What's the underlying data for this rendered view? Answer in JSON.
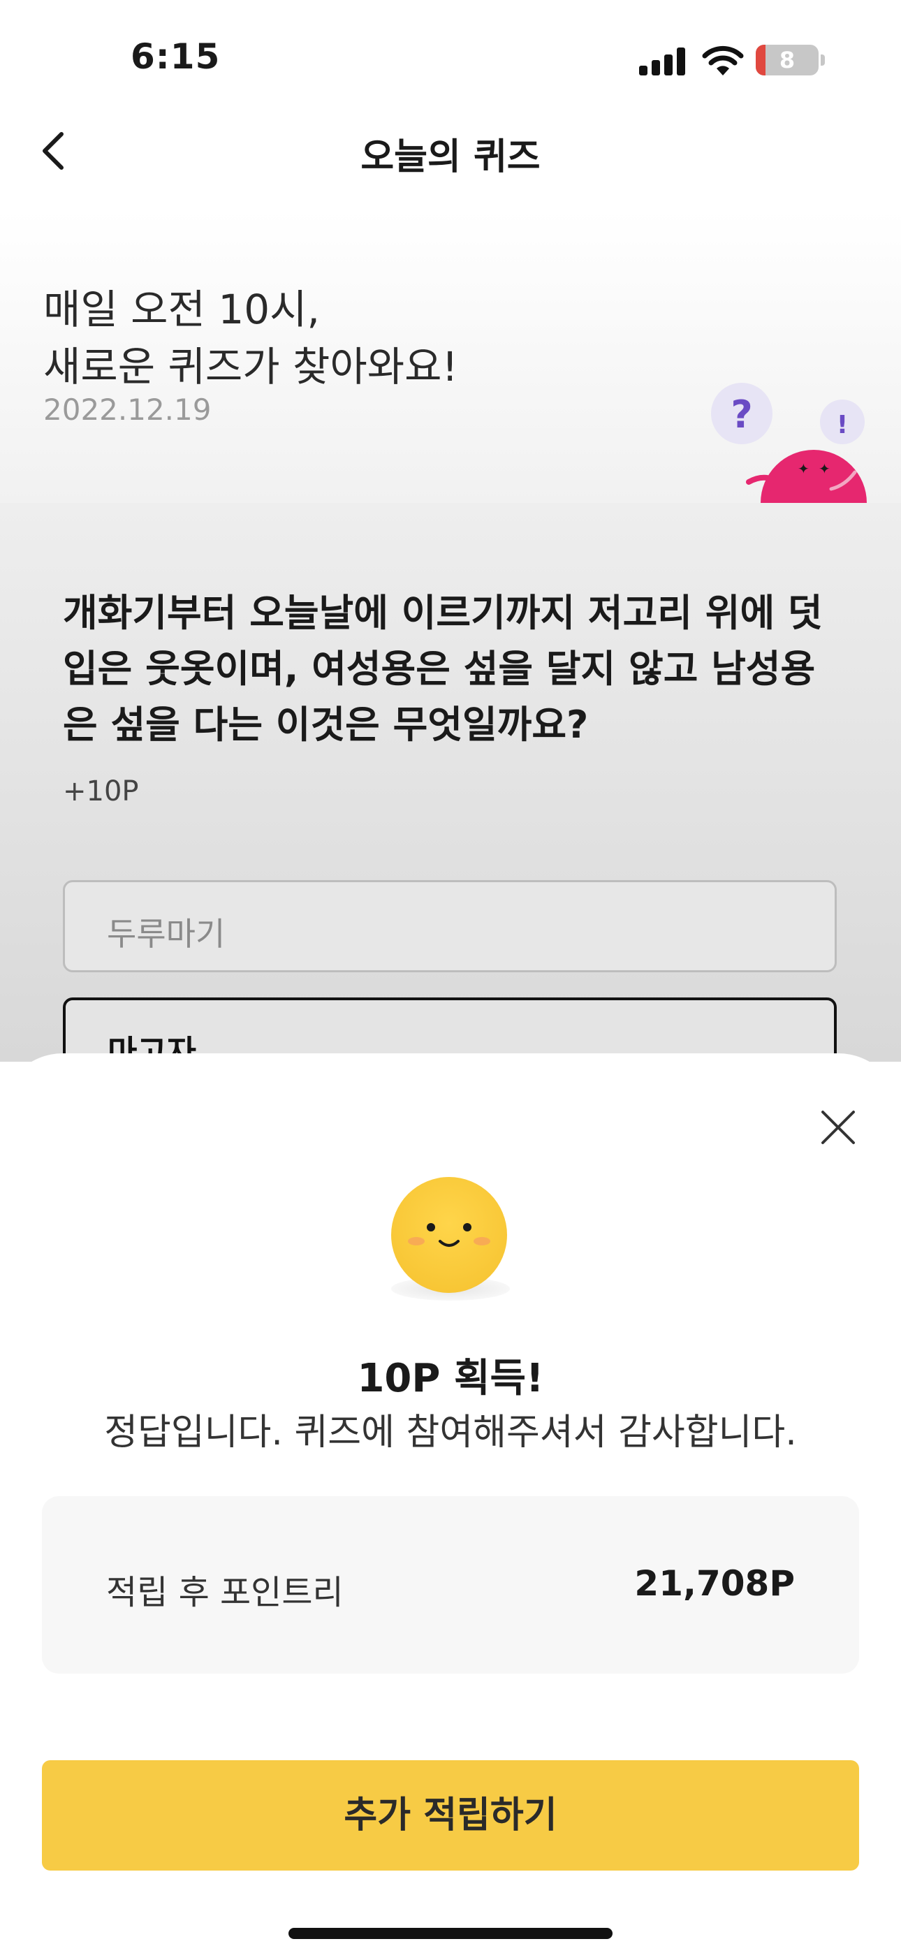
{
  "status_bar": {
    "time": "6:15",
    "battery": "8"
  },
  "nav": {
    "title": "오늘의 퀴즈"
  },
  "intro": {
    "line1": "매일 오전 10시,",
    "line2": "새로운 퀴즈가 찾아와요!",
    "date": "2022.12.19"
  },
  "quiz": {
    "question": "개화기부터 오늘날에 이르기까지 저고리 위에 덧입은 웃옷이며, 여성용은 섶을 달지 않고 남성용은 섶을 다는 이것은 무엇일까요?",
    "points": "+10P",
    "options": [
      "두루마기",
      "마고자"
    ]
  },
  "sheet": {
    "title": "10P 획득!",
    "subtitle": "정답입니다. 퀴즈에 참여해주셔서 감사합니다.",
    "balance_label": "적립 후 포인트리",
    "balance_value": "21,708P",
    "cta_label": "추가 적립하기"
  },
  "colors": {
    "accent": "#f7cb45",
    "mascot": "#e6276f",
    "smiley": "#f5c12e"
  },
  "icons": [
    "back-arrow-icon",
    "signal-icon",
    "wifi-icon",
    "battery-icon",
    "close-icon",
    "smiley-icon"
  ]
}
